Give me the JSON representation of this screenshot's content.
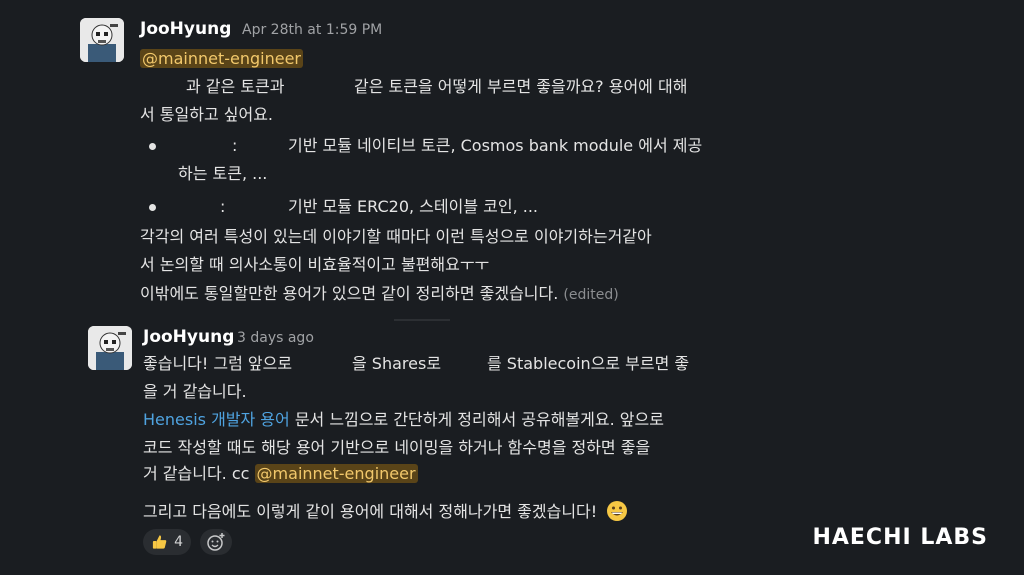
{
  "messages": [
    {
      "author": "JooHyung",
      "timestamp": "Apr 28th at 1:59 PM",
      "mention": "@mainnet-engineer",
      "lines": [
        "과 같은 토큰과",
        "같은 토큰을 어떻게 부르면 좋을까요? 용어에 대해",
        "서 통일하고 싶어요."
      ],
      "bullets": [
        {
          "sep": ":",
          "text1": "기반 모듈 네이티브 토큰, Cosmos bank module 에서 제공",
          "text2": "하는 토큰, ..."
        },
        {
          "sep": ":",
          "text1": "기반 모듈 ERC20, 스테이블 코인, ..."
        }
      ],
      "tail": [
        "각각의 여러 특성이 있는데 이야기할 때마다 이런 특성으로 이야기하는거같아",
        "서 논의할 때 의사소통이 비효율적이고 불편해요ㅜㅜ",
        "이밖에도 통일할만한 용어가 있으면 같이 정리하면 좋겠습니다."
      ],
      "edited": "(edited)"
    },
    {
      "author": "JooHyung",
      "timestamp": "3 days ago",
      "lines": [
        "좋습니다! 그럼 앞으로",
        "을 Shares로",
        "를 Stablecoin으로 부르면 좋",
        "을 거 같습니다."
      ],
      "link": "Henesis 개발자 용어",
      "link_rest": " 문서 느낌으로 간단하게 정리해서 공유해볼게요. 앞으로",
      "line2": "코드 작성할 때도 해당 용어 기반으로 네이밍을 하거나 함수명을 정하면 좋을",
      "line3": "거 같습니다. cc ",
      "mention": "@mainnet-engineer",
      "closing": "그리고 다음에도 이렇게 같이 용어에 대해서 정해나가면 좋겠습니다!",
      "reaction_count": "4"
    }
  ],
  "brand": "HAECHI LABS"
}
